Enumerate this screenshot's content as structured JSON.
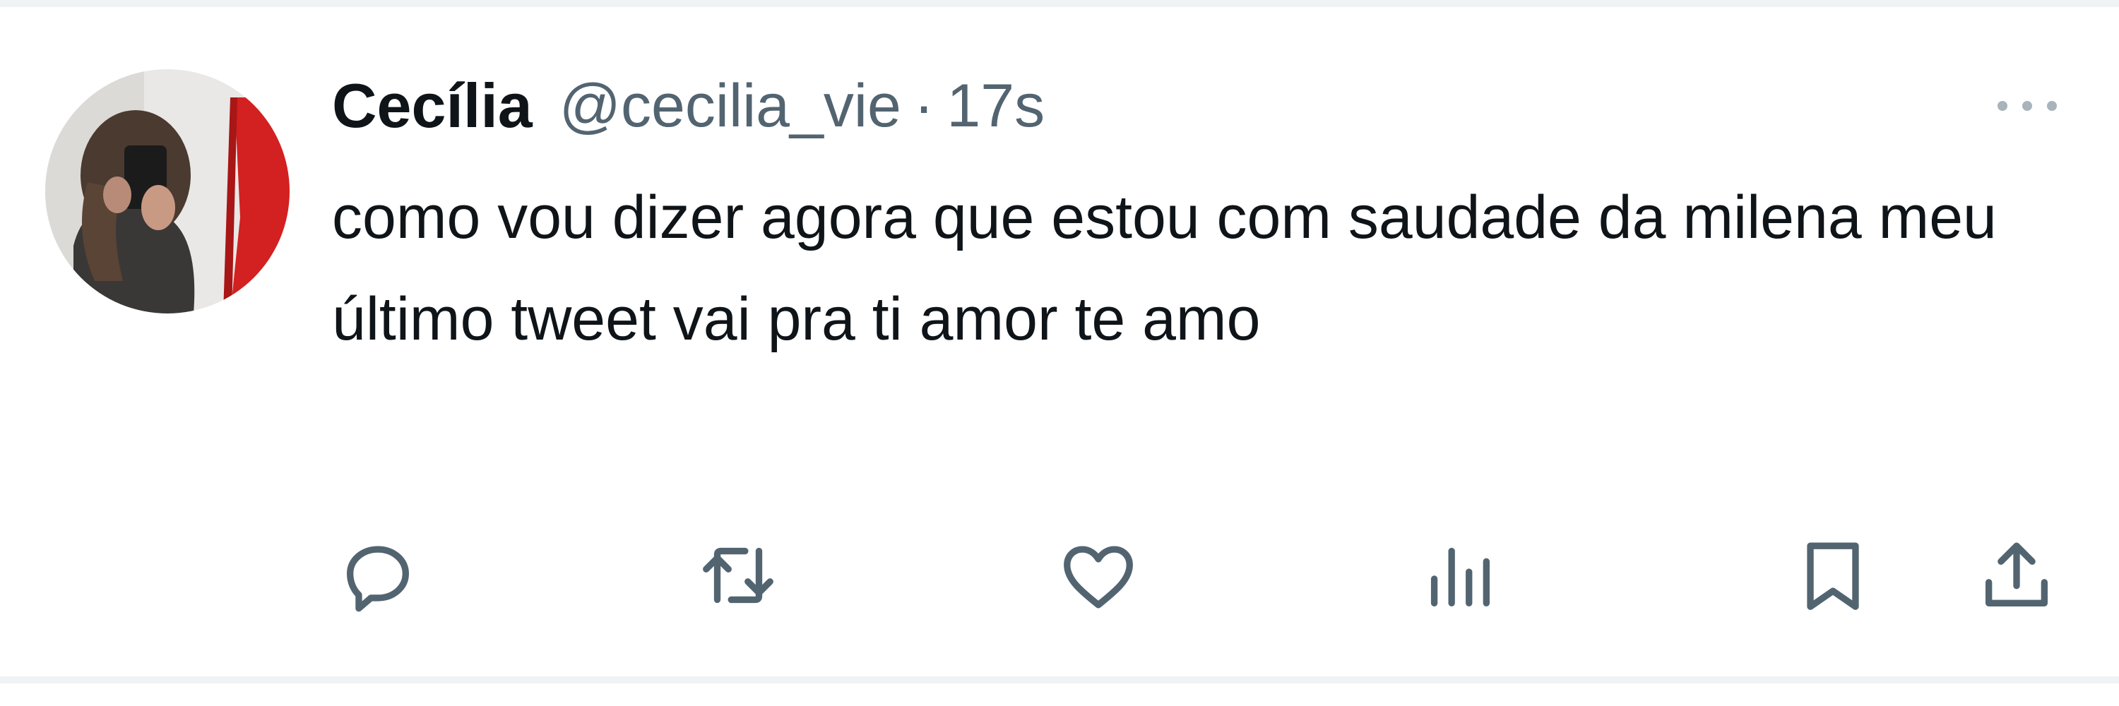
{
  "tweet": {
    "author": {
      "name": "Cecília",
      "handle": "@cecilia_vie",
      "separator": "·",
      "time": "17s"
    },
    "text": "como vou dizer agora que estou com saudade da milena meu último tweet vai pra ti amor te amo",
    "actions": [
      {
        "icon": "reply-icon"
      },
      {
        "icon": "retweet-icon"
      },
      {
        "icon": "like-icon"
      },
      {
        "icon": "views-icon"
      },
      {
        "icon": "bookmark-icon"
      },
      {
        "icon": "share-icon"
      }
    ]
  },
  "colors": {
    "text_primary": "#0f1419",
    "text_secondary": "#536471",
    "divider": "#eff3f4",
    "avatar_red": "#d32020"
  }
}
